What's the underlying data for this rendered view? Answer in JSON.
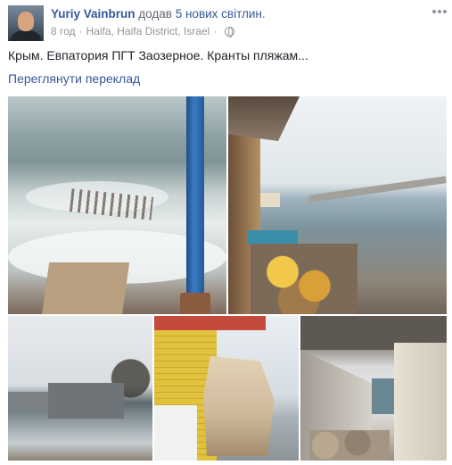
{
  "post": {
    "author": "Yuriy Vainbrun",
    "action_prefix": "додав",
    "action_count": "5 нових світлин",
    "action_suffix": ".",
    "time": "8 год",
    "separator": "·",
    "location": "Haifa, Haifa District, Israel",
    "privacy_icon": "globe-icon",
    "text": "Крым. Евпатория ПГТ Заозерное. Кранты пляжам...",
    "translate_link": "Переглянути переклад",
    "more_icon": "more-options-icon"
  },
  "photos": [
    {
      "label": "photo-1"
    },
    {
      "label": "photo-2"
    },
    {
      "label": "photo-3"
    },
    {
      "label": "photo-4"
    },
    {
      "label": "photo-5"
    }
  ],
  "colors": {
    "link": "#365899",
    "text": "#1d2129",
    "meta": "#90949c"
  }
}
